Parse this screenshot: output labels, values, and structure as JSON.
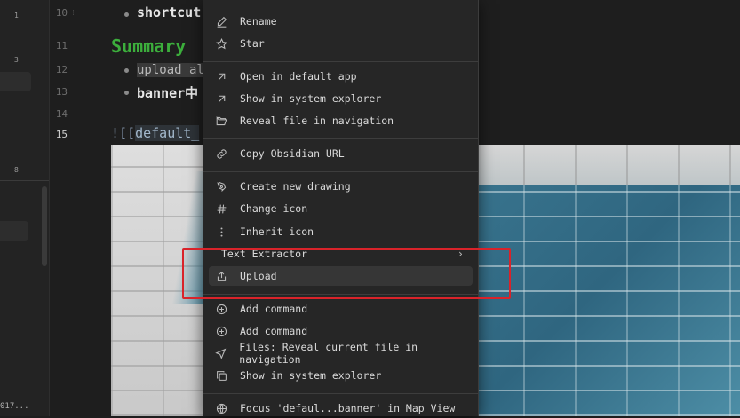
{
  "left_panel": {
    "numbers": [
      "1",
      "3",
      "8"
    ],
    "footer_text": "017..."
  },
  "editor": {
    "lines": [
      {
        "num": "10",
        "text": "shortcut"
      },
      {
        "num": "11",
        "text": "Summary"
      },
      {
        "num": "12",
        "text": "upload al"
      },
      {
        "num": "13",
        "text": "banner中"
      },
      {
        "num": "14",
        "text": ""
      },
      {
        "num": "15",
        "prefix": "![[",
        "link": "default_"
      }
    ]
  },
  "menu": {
    "items": [
      {
        "label": "Rename",
        "icon": "pencil-icon"
      },
      {
        "label": "Star",
        "icon": "star-icon"
      },
      {
        "label": "Open in default app",
        "icon": "arrow-up-right-icon"
      },
      {
        "label": "Show in system explorer",
        "icon": "arrow-up-right-icon"
      },
      {
        "label": "Reveal file in navigation",
        "icon": "folder-open-icon"
      },
      {
        "label": "Copy Obsidian URL",
        "icon": "link-icon"
      },
      {
        "label": "Create new drawing",
        "icon": "pen-tool-icon"
      },
      {
        "label": "Change icon",
        "icon": "hash-icon"
      },
      {
        "label": "Inherit icon",
        "icon": "vertical-dots-icon"
      },
      {
        "label": "Text Extractor",
        "icon": "",
        "submenu": true
      },
      {
        "label": "Upload",
        "icon": "share-icon"
      },
      {
        "label": "Add command",
        "icon": "plus-circle-icon"
      },
      {
        "label": "Add command",
        "icon": "plus-circle-icon"
      },
      {
        "label": "Files: Reveal current file in navigation",
        "icon": "navigation-icon"
      },
      {
        "label": "Show in system explorer",
        "icon": "copy-icon"
      },
      {
        "label": "Focus 'defaul...banner' in Map View",
        "icon": "globe-icon"
      }
    ]
  },
  "colors": {
    "accent_heading": "#3cae3c",
    "highlight_box": "#d9232a"
  }
}
